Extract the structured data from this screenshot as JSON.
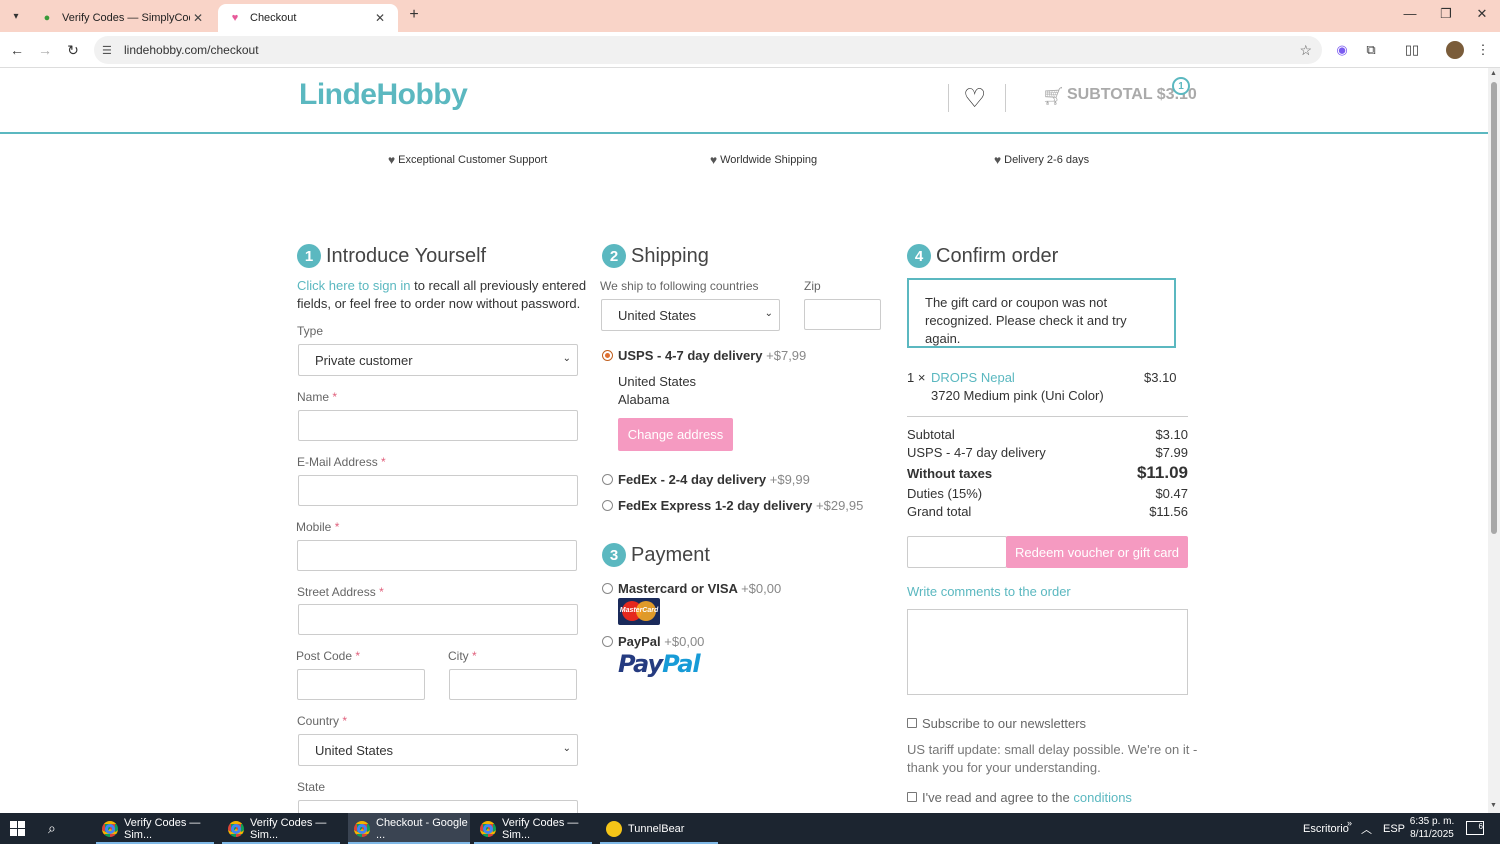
{
  "browser": {
    "tabs": [
      {
        "title": "Verify Codes — SimplyCodes",
        "active": false
      },
      {
        "title": "Checkout",
        "active": true
      }
    ],
    "url": "lindehobby.com/checkout"
  },
  "header": {
    "logo": "LindeHobby",
    "subtotal": "SUBTOTAL $3.10",
    "cart_count": "1"
  },
  "usps": [
    "Exceptional Customer Support",
    "Worldwide Shipping",
    "Delivery 2-6 days"
  ],
  "step1": {
    "num": "1",
    "title": "Introduce Yourself",
    "signin_link": "Click here to sign in",
    "signin_text_1": "to recall all previously entered",
    "signin_text_2": "fields, or feel free to order now without password.",
    "type_label": "Type",
    "type_value": "Private customer",
    "name_label": "Name",
    "email_label": "E-Mail Address",
    "mobile_label": "Mobile",
    "street_label": "Street Address",
    "postcode_label": "Post Code",
    "city_label": "City",
    "country_label": "Country",
    "country_value": "United States",
    "state_label": "State",
    "required_mark": "*"
  },
  "step2": {
    "num": "2",
    "title": "Shipping",
    "ship_to_label": "We ship to following countries",
    "country_value": "United States",
    "zip_label": "Zip",
    "options": [
      {
        "name": "USPS - 4-7 day delivery",
        "price": "+$7,99",
        "checked": true
      },
      {
        "name": "FedEx - 2-4 day delivery",
        "price": "+$9,99",
        "checked": false
      },
      {
        "name": "FedEx Express 1-2 day delivery",
        "price": "+$29,95",
        "checked": false
      }
    ],
    "address_line1": "United States",
    "address_line2": "Alabama",
    "change_address": "Change address"
  },
  "step3": {
    "num": "3",
    "title": "Payment",
    "options": [
      {
        "name": "Mastercard or VISA",
        "price": "+$0,00"
      },
      {
        "name": "PayPal",
        "price": "+$0,00"
      }
    ],
    "mastercard_logo": "MasterCard",
    "paypal_logo_a": "Pay",
    "paypal_logo_b": "Pal"
  },
  "step4": {
    "num": "4",
    "title": "Confirm order",
    "notice_1": "The gift card or coupon was not",
    "notice_2": "recognized. Please check it and try again.",
    "item": {
      "qty": "1 ×",
      "name": "DROPS Nepal",
      "variant": "3720 Medium pink (Uni Color)",
      "price": "$3.10"
    },
    "summary": [
      {
        "label": "Subtotal",
        "value": "$3.10"
      },
      {
        "label": "USPS - 4-7 day delivery",
        "value": "$7.99"
      },
      {
        "label": "Without taxes",
        "value": "$11.09"
      },
      {
        "label": "Duties (15%)",
        "value": "$0.47"
      },
      {
        "label": "Grand total",
        "value": "$11.56"
      }
    ],
    "redeem_button": "Redeem voucher or gift card",
    "comments_link": "Write comments to the order",
    "newsletter": "Subscribe to our newsletters",
    "tariff_1": "US tariff update: small delay possible. We're on it -",
    "tariff_2": "thank you for your understanding.",
    "agree_text": "I've read and agree to the",
    "agree_link": "conditions"
  },
  "taskbar": {
    "items": [
      {
        "label": "Verify Codes — Sim...",
        "icon": "chrome"
      },
      {
        "label": "Verify Codes — Sim...",
        "icon": "chrome"
      },
      {
        "label": "Checkout - Google ...",
        "icon": "chrome"
      },
      {
        "label": "Verify Codes — Sim...",
        "icon": "chrome"
      },
      {
        "label": "TunnelBear",
        "icon": "tunnelbear"
      }
    ],
    "desktop": "Escritorio",
    "lang": "ESP",
    "time": "6:35 p. m.",
    "date": "8/11/2025",
    "notifications": "6"
  },
  "colors": {
    "accent": "#5bb8c0",
    "pink": "#f59ac1",
    "tabbar": "#f9d4c8"
  }
}
